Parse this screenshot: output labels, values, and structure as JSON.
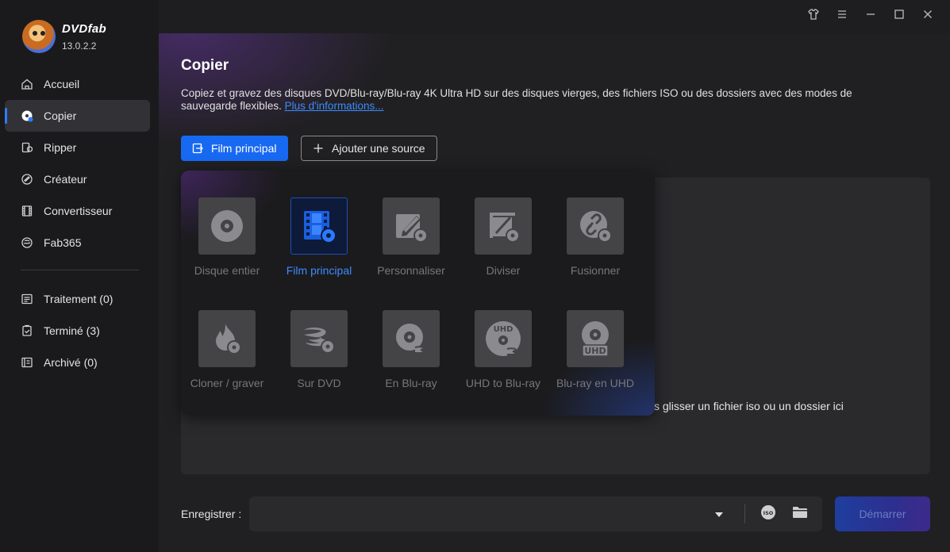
{
  "app": {
    "brand_name": "DVDfab",
    "version": "13.0.2.2"
  },
  "sidebar": {
    "items": [
      {
        "label": "Accueil",
        "icon": "home-icon"
      },
      {
        "label": "Copier",
        "icon": "copy-disc-icon",
        "active": true
      },
      {
        "label": "Ripper",
        "icon": "ripper-icon"
      },
      {
        "label": "Créateur",
        "icon": "creator-icon"
      },
      {
        "label": "Convertisseur",
        "icon": "film-icon"
      },
      {
        "label": "Fab365",
        "icon": "cloud-icon"
      }
    ],
    "queue": [
      {
        "label": "Traitement (0)",
        "icon": "list-icon"
      },
      {
        "label": "Terminé (3)",
        "icon": "clipboard-check-icon"
      },
      {
        "label": "Archivé (0)",
        "icon": "archive-icon"
      }
    ]
  },
  "main": {
    "title": "Copier",
    "description": "Copiez et gravez des disques DVD/Blu-ray/Blu-ray 4K Ultra HD sur des disques vierges, des fichiers ISO ou des dossiers avec des modes de sauvegarde flexibles. ",
    "more_link": "Plus d'informations...",
    "primary_button": "Film principal",
    "add_source_button": "Ajouter une source",
    "drop_hint": "s glisser un fichier iso ou un dossier ici"
  },
  "modes": [
    {
      "label": "Disque entier",
      "icon": "disc-icon"
    },
    {
      "label": "Film principal",
      "icon": "film-disc-icon",
      "selected": true
    },
    {
      "label": "Personnaliser",
      "icon": "edit-disc-icon"
    },
    {
      "label": "Diviser",
      "icon": "crop-disc-icon"
    },
    {
      "label": "Fusionner",
      "icon": "link-disc-icon"
    },
    {
      "label": "Cloner / graver",
      "icon": "flame-disc-icon"
    },
    {
      "label": "Sur DVD",
      "icon": "bluray-to-dvd-icon"
    },
    {
      "label": "En Blu-ray",
      "icon": "bluray-disc-icon"
    },
    {
      "label": "UHD to Blu-ray",
      "icon": "uhd-bluray-icon"
    },
    {
      "label": "Blu-ray en UHD",
      "icon": "uhd-disc-icon"
    }
  ],
  "bottom": {
    "save_label": "Enregistrer :",
    "save_value": "",
    "start_button": "Démarrer"
  },
  "colors": {
    "accent": "#1869f2",
    "link": "#3d8bff"
  }
}
